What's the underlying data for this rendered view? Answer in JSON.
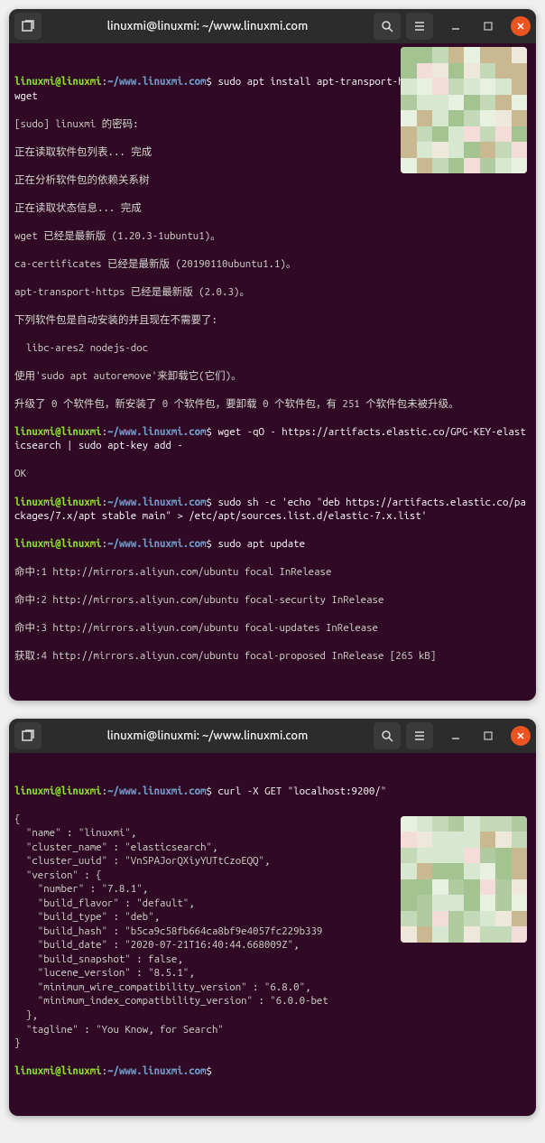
{
  "window1": {
    "title": "linuxmi@linuxmi: ~/www.linuxmi.com",
    "prompt_user": "linuxmi@linuxmi",
    "prompt_path": "~/www.linuxmi.com",
    "prompt_sep": ":",
    "prompt_dollar": "$",
    "cmd1": " sudo apt install apt-transport-https ca-certificates wget",
    "out1": "[sudo] linuxmi 的密码:",
    "out2": "正在读取软件包列表... 完成",
    "out3": "正在分析软件包的依赖关系树",
    "out4": "正在读取状态信息... 完成",
    "out5": "wget 已经是最新版 (1.20.3-1ubuntu1)。",
    "out6": "ca-certificates 已经是最新版 (20190110ubuntu1.1)。",
    "out7": "apt-transport-https 已经是最新版 (2.0.3)。",
    "out8": "下列软件包是自动安装的并且现在不需要了:",
    "out9": "  libc-ares2 nodejs-doc",
    "out10": "使用'sudo apt autoremove'来卸载它(它们)。",
    "out11": "升级了 0 个软件包，新安装了 0 个软件包，要卸载 0 个软件包，有 251 个软件包未被升级。",
    "cmd2": " wget -qO - https://artifacts.elastic.co/GPG-KEY-elasticsearch | sudo apt-key add -",
    "out12": "OK",
    "cmd3": " sudo sh -c 'echo \"deb https://artifacts.elastic.co/packages/7.x/apt stable main\" > /etc/apt/sources.list.d/elastic-7.x.list'",
    "cmd4": " sudo apt update",
    "out13": "命中:1 http://mirrors.aliyun.com/ubuntu focal InRelease",
    "out14": "命中:2 http://mirrors.aliyun.com/ubuntu focal-security InRelease",
    "out15": "命中:3 http://mirrors.aliyun.com/ubuntu focal-updates InRelease",
    "out16": "获取:4 http://mirrors.aliyun.com/ubuntu focal-proposed InRelease [265 kB]"
  },
  "window2": {
    "title": "linuxmi@linuxmi: ~/www.linuxmi.com",
    "prompt_user": "linuxmi@linuxmi",
    "prompt_path": "~/www.linuxmi.com",
    "prompt_sep": ":",
    "prompt_dollar": "$",
    "cmd1": " curl -X GET \"localhost:9200/\"",
    "json_lines": [
      "{",
      "  \"name\" : \"linuxmi\",",
      "  \"cluster_name\" : \"elasticsearch\",",
      "  \"cluster_uuid\" : \"VnSPAJorQXiyYUTtCzoEQQ\",",
      "  \"version\" : {",
      "    \"number\" : \"7.8.1\",",
      "    \"build_flavor\" : \"default\",",
      "    \"build_type\" : \"deb\",",
      "    \"build_hash\" : \"b5ca9c58fb664ca8bf9e4057fc229b339",
      "    \"build_date\" : \"2020-07-21T16:40:44.668009Z\",",
      "    \"build_snapshot\" : false,",
      "    \"lucene_version\" : \"8.5.1\",",
      "    \"minimum_wire_compatibility_version\" : \"6.8.0\",",
      "    \"minimum_index_compatibility_version\" : \"6.0.0-bet",
      "  },",
      "  \"tagline\" : \"You Know, for Search\"",
      "}"
    ]
  },
  "pixel_colors": [
    "#d8e8d0",
    "#c3d9b8",
    "#b0cba0",
    "#e8f0e0",
    "#f4dcd8",
    "#a3c490",
    "#ede8da",
    "#c9b890"
  ]
}
